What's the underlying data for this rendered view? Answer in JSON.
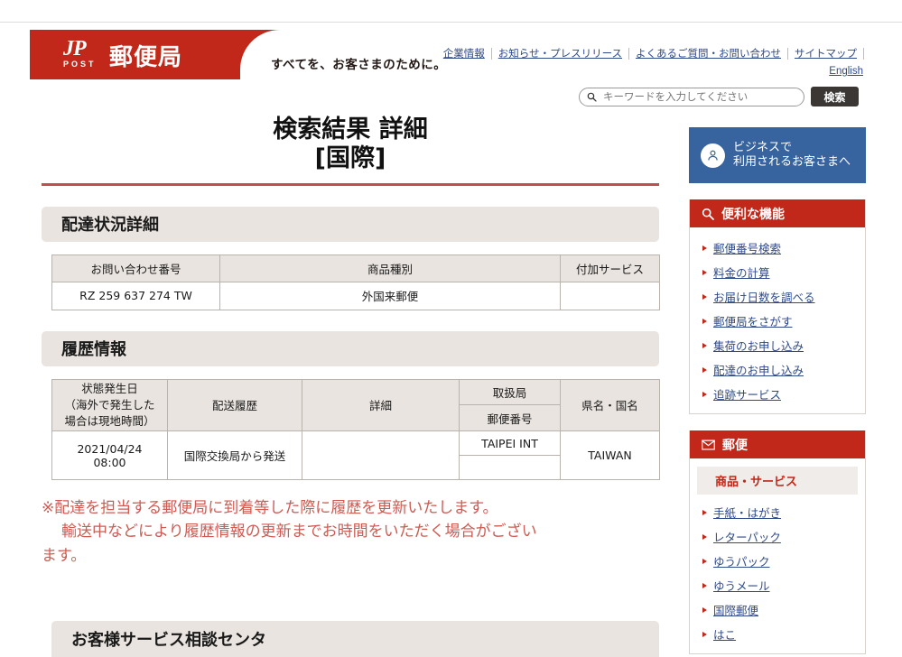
{
  "header": {
    "logo_text": "郵便局",
    "logo_mark": "JP",
    "logo_mark_sub": "POST",
    "tagline": "すべてを、お客さまのために。",
    "util_links": [
      "企業情報",
      "お知らせ・プレスリリース",
      "よくあるご質問・お問い合わせ",
      "サイトマップ"
    ],
    "english_link": "English"
  },
  "search": {
    "placeholder": "キーワードを入力してください",
    "value": "",
    "button_label": "検索",
    "icon": "search-icon"
  },
  "main": {
    "title_line1": "検索結果 詳細",
    "title_line2": "[国際]",
    "status_section": {
      "heading": "配達状況詳細",
      "columns": [
        "お問い合わせ番号",
        "商品種別",
        "付加サービス"
      ],
      "rows": [
        [
          "RZ 259 637 274 TW",
          "外国来郵便",
          ""
        ]
      ]
    },
    "history_section": {
      "heading": "履歴情報",
      "columns": {
        "date": "状態発生日\n（海外で発生した\n場合は現地時間）",
        "date_l1": "状態発生日",
        "date_l2": "（海外で発生した",
        "date_l3": "場合は現地時間）",
        "shipping": "配送履歴",
        "detail": "詳細",
        "office": "取扱局",
        "zip": "郵便番号",
        "region": "県名・国名"
      },
      "rows": [
        {
          "date_l1": "2021/04/24",
          "date_l2": "08:00",
          "shipping": "国際交換局から発送",
          "detail": "",
          "office": "TAIPEI INT",
          "zip": "",
          "region": "TAIWAN"
        }
      ]
    },
    "notice_line1": "※配達を担当する郵便局に到着等した際に履歴を更新いたします。",
    "notice_line2": "輸送中などにより履歴情報の更新までお時間をいただく場合がござい",
    "notice_line3": "ます。",
    "bottom_heading": "お客様サービス相談センタ"
  },
  "sidebar": {
    "business_banner": {
      "line1": "ビジネスで",
      "line2": "利用されるお客さまへ",
      "icon": "business-user-icon",
      "color": "#37649e"
    },
    "panels": [
      {
        "heading": "便利な機能",
        "icon": "search-icon",
        "items": [
          "郵便番号検索",
          "料金の計算",
          "お届け日数を調べる",
          "郵便局をさがす",
          "集荷のお申し込み",
          "配達のお申し込み",
          "追跡サービス"
        ]
      },
      {
        "heading": "郵便",
        "icon": "envelope-icon",
        "sub_heading": "商品・サービス",
        "items": [
          "手紙・はがき",
          "レターパック",
          "ゆうパック",
          "ゆうメール",
          "国際郵便",
          "はこ"
        ]
      }
    ]
  },
  "colors": {
    "brand_red": "#c1281a",
    "link_blue": "#2f4a8a",
    "panel_beige": "#e9e4df",
    "notice_red": "#cf5a52",
    "business_blue": "#37649e"
  }
}
